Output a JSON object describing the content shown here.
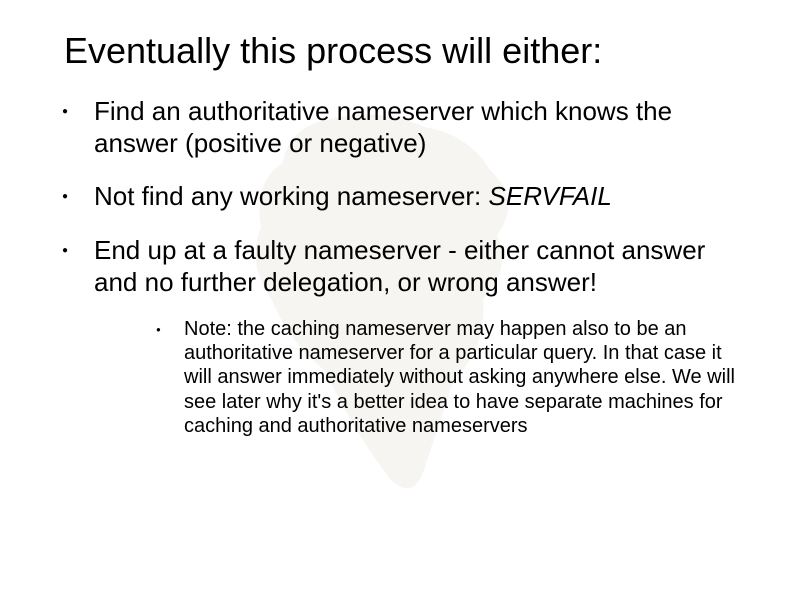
{
  "title": "Eventually this process will either:",
  "bullets": {
    "b1": "Find an authoritative nameserver which knows the answer (positive or negative)",
    "b2_pre": "Not find any working nameserver: ",
    "b2_em": "SERVFAIL",
    "b3": "End up at a faulty nameserver - either cannot answer and no further delegation, or wrong answer!",
    "b3_sub": "Note: the caching nameserver may happen also to be an authoritative nameserver for a particular query. In that case it will answer immediately without asking anywhere else. We will see later why it's a better idea to have separate machines for caching and authoritative nameservers"
  }
}
